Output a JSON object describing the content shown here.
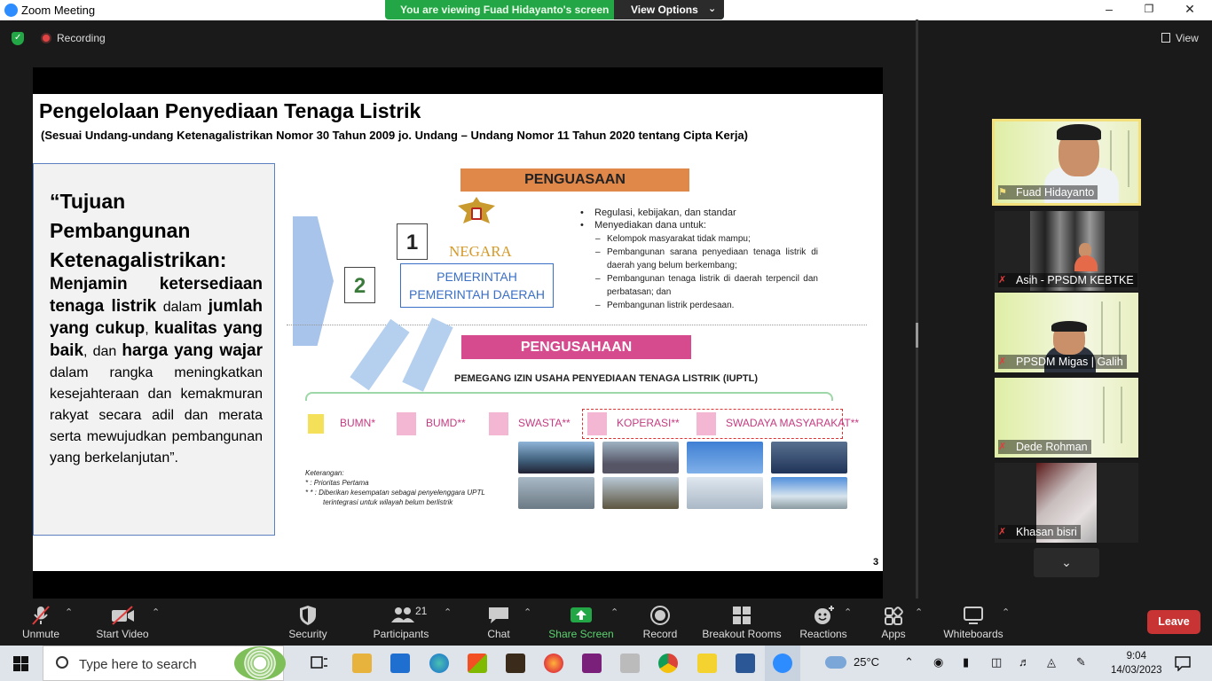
{
  "window": {
    "title": "Zoom Meeting",
    "viewing_banner": "You are viewing Fuad Hidayanto's screen",
    "view_options_label": "View Options",
    "minimize": "–",
    "maximize": "❐",
    "close": "✕"
  },
  "top": {
    "recording_label": "Recording",
    "view_label": "View"
  },
  "slide": {
    "title": "Pengelolaan Penyediaan Tenaga Listrik",
    "subtitle": "(Sesuai Undang-undang Ketenagalistrikan Nomor 30 Tahun 2009 jo. Undang – Undang Nomor 11 Tahun 2020 tentang Cipta Kerja)",
    "left_heading": "“Tujuan Pembangunan Ketenagalistrikan:",
    "left_p1": "Menjamin ketersediaan tenaga listrik",
    "left_p2": " dalam ",
    "left_p3": "jumlah yang cukup",
    "left_p4": ", ",
    "left_p5": "kualitas yang baik",
    "left_p6": ", dan ",
    "left_p7": "harga yang wajar",
    "left_p8": " dalam rangka meningkatkan kesejahteraan dan kemakmuran rakyat secara adil dan merata serta mewujudkan pembangunan yang berkelanjutan”.",
    "penguasaan": "PENGUASAAN",
    "num1": "1",
    "num2": "2",
    "negara": "NEGARA",
    "pemerintah_1": "PEMERINTAH",
    "pemerintah_2": "PEMERINTAH DAERAH",
    "bullets": [
      "Regulasi, kebijakan, dan standar",
      "Menyediakan dana untuk:"
    ],
    "sub_bullets": [
      "Kelompok masyarakat tidak mampu;",
      "Pembangunan sarana penyediaan tenaga listrik di daerah yang belum berkembang;",
      "Pembangunan tenaga listrik di daerah terpencil dan perbatasan; dan",
      "Pembangunan listrik perdesaan."
    ],
    "pengusahaan": "PENGUSAHAAN",
    "iuptl": "PEMEGANG IZIN USAHA PENYEDIAAN TENAGA LISTRIK (IUPTL)",
    "entities": [
      "BUMN*",
      "BUMD**",
      "SWASTA**",
      "KOPERASI**",
      "SWADAYA MASYARAKAT**"
    ],
    "keterangan_title": "Keterangan:",
    "keterangan_1": "*     : Prioritas Pertama",
    "keterangan_2": "* *  : Diberikan kesempatan sebagai penyelenggara UPTL",
    "keterangan_3": "terintegrasi untuk wilayah belum berlistrik",
    "page_number": "3"
  },
  "participants": [
    {
      "name": "Fuad Hidayanto",
      "active": true
    },
    {
      "name": "Asih - PPSDM KEBTKE"
    },
    {
      "name": "PPSDM Migas | Galih"
    },
    {
      "name": "Dede Rohman"
    },
    {
      "name": "Khasan bisri"
    }
  ],
  "toolbar": {
    "unmute": "Unmute",
    "start_video": "Start Video",
    "security": "Security",
    "participants": "Participants",
    "participants_count": "21",
    "chat": "Chat",
    "share_screen": "Share Screen",
    "record": "Record",
    "breakout": "Breakout Rooms",
    "reactions": "Reactions",
    "apps": "Apps",
    "whiteboards": "Whiteboards",
    "leave": "Leave"
  },
  "taskbar": {
    "search_placeholder": "Type here to search",
    "temperature": "25°C",
    "time": "9:04",
    "date": "14/03/2023"
  },
  "colors": {
    "zoom_green": "#23a746",
    "leave_red": "#c83434",
    "penguasaan_orange": "#e0874a",
    "pengusahaan_pink": "#d64a8e",
    "active_speaker": "#f3e07a"
  }
}
